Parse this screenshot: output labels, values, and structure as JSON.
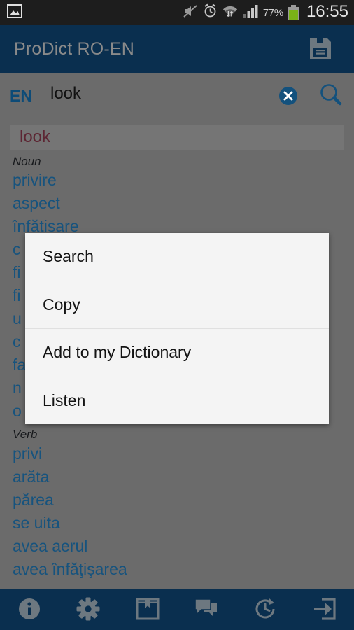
{
  "statusbar": {
    "gallery_icon": "image-icon",
    "mute_icon": "mute-icon",
    "alarm_icon": "alarm-clock-icon",
    "wifi_icon": "wifi-transfer-icon",
    "signal_icon": "signal-bars-icon",
    "battery_percent": "77%",
    "battery_icon": "battery-icon",
    "time": "16:55",
    "battery_color": "#7ab317"
  },
  "appbar": {
    "title": "ProDict RO-EN",
    "save_icon": "floppy-save-icon",
    "background": "#0a2f4f",
    "title_color": "#8a8a8a"
  },
  "search": {
    "language": "EN",
    "value": "look",
    "placeholder": "",
    "clear_icon": "clear-circle-icon",
    "search_icon": "search-icon",
    "accent": "#0d4b77"
  },
  "results": {
    "headword": "look",
    "headword_color": "#5d2633",
    "entry_color": "#16537e",
    "sections": [
      {
        "pos": "Noun",
        "entries": [
          "privire",
          "aspect",
          "înfătisare",
          "c",
          "fi",
          "fi",
          "u",
          "c",
          "fa",
          "n",
          "o"
        ]
      },
      {
        "pos": "Verb",
        "entries": [
          "privi",
          "arăta",
          "părea",
          "se uita",
          "avea aerul",
          "avea înfăţişarea"
        ]
      }
    ]
  },
  "dialog": {
    "items": [
      {
        "label": "Search",
        "name": "dialog-item-search"
      },
      {
        "label": "Copy",
        "name": "dialog-item-copy"
      },
      {
        "label": "Add to my Dictionary",
        "name": "dialog-item-add-to-my-dictionary"
      },
      {
        "label": "Listen",
        "name": "dialog-item-listen"
      }
    ]
  },
  "bottombar": {
    "buttons": [
      {
        "icon": "info-icon",
        "name": "bottom-button-info"
      },
      {
        "icon": "gear-icon",
        "name": "bottom-button-settings"
      },
      {
        "icon": "book-bookmark-icon",
        "name": "bottom-button-dictionary"
      },
      {
        "icon": "chat-bubbles-icon",
        "name": "bottom-button-phrases"
      },
      {
        "icon": "history-clock-icon",
        "name": "bottom-button-history"
      },
      {
        "icon": "exit-arrow-icon",
        "name": "bottom-button-exit"
      }
    ],
    "icon_color": "#6d7880"
  }
}
